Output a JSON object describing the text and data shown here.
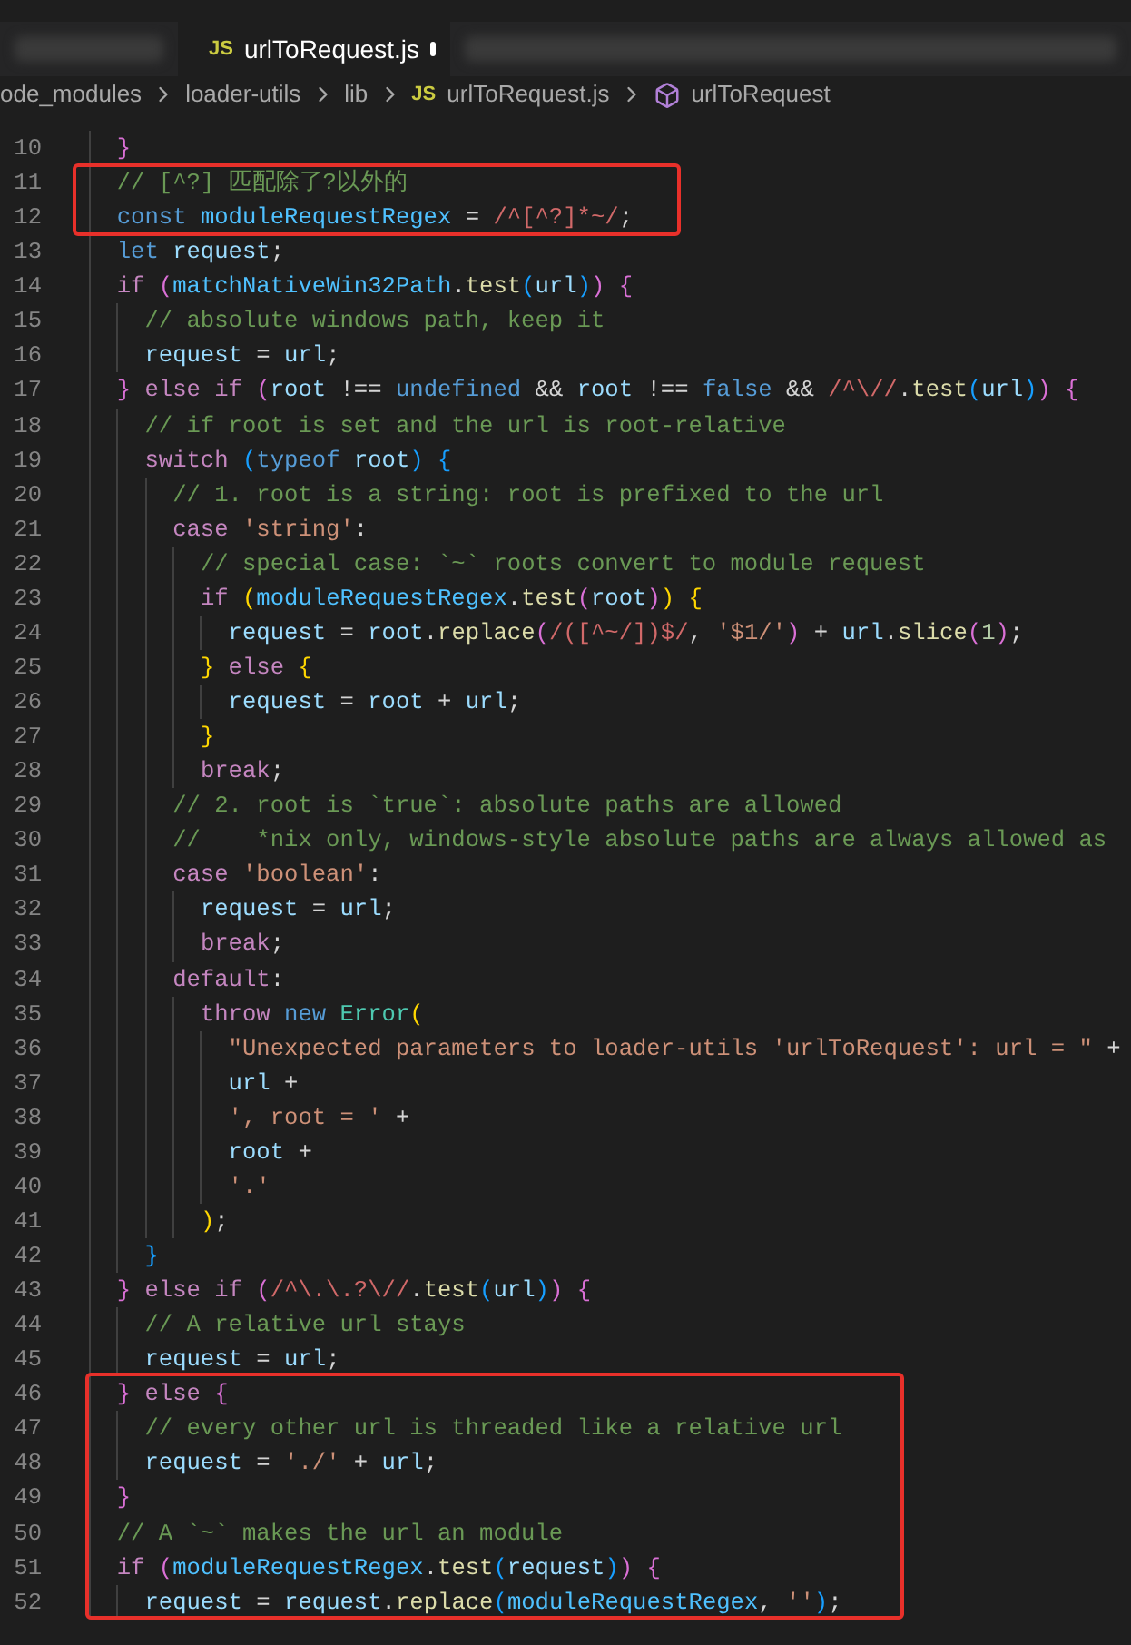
{
  "tabs": [
    {
      "kind": "blurred",
      "selected": false
    },
    {
      "kind": "file",
      "icon_text": "JS",
      "label": "urlToRequest.js",
      "modified": true,
      "selected": true
    },
    {
      "kind": "blurred",
      "selected": false
    }
  ],
  "breadcrumbs": [
    {
      "kind": "folder",
      "label": "ode_modules"
    },
    {
      "kind": "folder",
      "label": "loader-utils"
    },
    {
      "kind": "folder",
      "label": "lib"
    },
    {
      "kind": "file",
      "icon_text": "JS",
      "label": "urlToRequest.js"
    },
    {
      "kind": "symbol",
      "label": "urlToRequest"
    }
  ],
  "lines": [
    {
      "number": "10",
      "tokens": [
        {
          "kind": "bracket2",
          "text": "  }"
        }
      ]
    },
    {
      "number": "11",
      "tokens": [
        {
          "kind": "comment",
          "text": "  // [^?] 匹配除了?以外的"
        }
      ]
    },
    {
      "number": "12",
      "tokens": [
        {
          "kind": "keyword",
          "text": "  const "
        },
        {
          "kind": "constant",
          "text": "moduleRequestRegex"
        },
        {
          "kind": "plain",
          "text": " = "
        },
        {
          "kind": "regex",
          "text": "/^[^?]*~/"
        },
        {
          "kind": "plain",
          "text": ";"
        }
      ]
    },
    {
      "number": "13",
      "tokens": [
        {
          "kind": "keyword",
          "text": "  let "
        },
        {
          "kind": "variable",
          "text": "request"
        },
        {
          "kind": "plain",
          "text": ";"
        }
      ]
    },
    {
      "number": "14",
      "tokens": [
        {
          "kind": "control",
          "text": "  if "
        },
        {
          "kind": "bracket2",
          "text": "("
        },
        {
          "kind": "constant",
          "text": "matchNativeWin32Path"
        },
        {
          "kind": "plain",
          "text": "."
        },
        {
          "kind": "function",
          "text": "test"
        },
        {
          "kind": "bracket3",
          "text": "("
        },
        {
          "kind": "variable",
          "text": "url"
        },
        {
          "kind": "bracket3",
          "text": ")"
        },
        {
          "kind": "bracket2",
          "text": ") {"
        }
      ]
    },
    {
      "number": "15",
      "tokens": [
        {
          "kind": "comment",
          "text": "    // absolute windows path, keep it"
        }
      ]
    },
    {
      "number": "16",
      "tokens": [
        {
          "kind": "variable",
          "text": "    request"
        },
        {
          "kind": "plain",
          "text": " = "
        },
        {
          "kind": "variable",
          "text": "url"
        },
        {
          "kind": "plain",
          "text": ";"
        }
      ]
    },
    {
      "number": "17",
      "tokens": [
        {
          "kind": "bracket2",
          "text": "  } "
        },
        {
          "kind": "control",
          "text": "else if "
        },
        {
          "kind": "bracket2",
          "text": "("
        },
        {
          "kind": "variable",
          "text": "root"
        },
        {
          "kind": "plain",
          "text": " !== "
        },
        {
          "kind": "keyword",
          "text": "undefined"
        },
        {
          "kind": "plain",
          "text": " && "
        },
        {
          "kind": "variable",
          "text": "root"
        },
        {
          "kind": "plain",
          "text": " !== "
        },
        {
          "kind": "keyword",
          "text": "false"
        },
        {
          "kind": "plain",
          "text": " && "
        },
        {
          "kind": "regex",
          "text": "/^\\//"
        },
        {
          "kind": "plain",
          "text": "."
        },
        {
          "kind": "function",
          "text": "test"
        },
        {
          "kind": "bracket3",
          "text": "("
        },
        {
          "kind": "variable",
          "text": "url"
        },
        {
          "kind": "bracket3",
          "text": ")"
        },
        {
          "kind": "bracket2",
          "text": ") {"
        }
      ]
    },
    {
      "number": "18",
      "tokens": [
        {
          "kind": "comment",
          "text": "    // if root is set and the url is root-relative"
        }
      ]
    },
    {
      "number": "19",
      "tokens": [
        {
          "kind": "control",
          "text": "    switch "
        },
        {
          "kind": "bracket3",
          "text": "("
        },
        {
          "kind": "keyword",
          "text": "typeof "
        },
        {
          "kind": "variable",
          "text": "root"
        },
        {
          "kind": "bracket3",
          "text": ") {"
        }
      ]
    },
    {
      "number": "20",
      "tokens": [
        {
          "kind": "comment",
          "text": "      // 1. root is a string: root is prefixed to the url"
        }
      ]
    },
    {
      "number": "21",
      "tokens": [
        {
          "kind": "control",
          "text": "      case "
        },
        {
          "kind": "string",
          "text": "'string'"
        },
        {
          "kind": "plain",
          "text": ":"
        }
      ]
    },
    {
      "number": "22",
      "tokens": [
        {
          "kind": "comment",
          "text": "        // special case: `~` roots convert to module request"
        }
      ]
    },
    {
      "number": "23",
      "tokens": [
        {
          "kind": "control",
          "text": "        if "
        },
        {
          "kind": "bracket1",
          "text": "("
        },
        {
          "kind": "constant",
          "text": "moduleRequestRegex"
        },
        {
          "kind": "plain",
          "text": "."
        },
        {
          "kind": "function",
          "text": "test"
        },
        {
          "kind": "bracket2",
          "text": "("
        },
        {
          "kind": "variable",
          "text": "root"
        },
        {
          "kind": "bracket2",
          "text": ")"
        },
        {
          "kind": "bracket1",
          "text": ") {"
        }
      ]
    },
    {
      "number": "24",
      "tokens": [
        {
          "kind": "variable",
          "text": "          request"
        },
        {
          "kind": "plain",
          "text": " = "
        },
        {
          "kind": "variable",
          "text": "root"
        },
        {
          "kind": "plain",
          "text": "."
        },
        {
          "kind": "function",
          "text": "replace"
        },
        {
          "kind": "bracket2",
          "text": "("
        },
        {
          "kind": "regex",
          "text": "/([^~/])$/"
        },
        {
          "kind": "plain",
          "text": ", "
        },
        {
          "kind": "string",
          "text": "'$1/'"
        },
        {
          "kind": "bracket2",
          "text": ")"
        },
        {
          "kind": "plain",
          "text": " + "
        },
        {
          "kind": "variable",
          "text": "url"
        },
        {
          "kind": "plain",
          "text": "."
        },
        {
          "kind": "function",
          "text": "slice"
        },
        {
          "kind": "bracket2",
          "text": "("
        },
        {
          "kind": "number",
          "text": "1"
        },
        {
          "kind": "bracket2",
          "text": ")"
        },
        {
          "kind": "plain",
          "text": ";"
        }
      ]
    },
    {
      "number": "25",
      "tokens": [
        {
          "kind": "bracket1",
          "text": "        } "
        },
        {
          "kind": "control",
          "text": "else "
        },
        {
          "kind": "bracket1",
          "text": "{"
        }
      ]
    },
    {
      "number": "26",
      "tokens": [
        {
          "kind": "variable",
          "text": "          request"
        },
        {
          "kind": "plain",
          "text": " = "
        },
        {
          "kind": "variable",
          "text": "root"
        },
        {
          "kind": "plain",
          "text": " + "
        },
        {
          "kind": "variable",
          "text": "url"
        },
        {
          "kind": "plain",
          "text": ";"
        }
      ]
    },
    {
      "number": "27",
      "tokens": [
        {
          "kind": "bracket1",
          "text": "        }"
        }
      ]
    },
    {
      "number": "28",
      "tokens": [
        {
          "kind": "control",
          "text": "        break"
        },
        {
          "kind": "plain",
          "text": ";"
        }
      ]
    },
    {
      "number": "29",
      "tokens": [
        {
          "kind": "comment",
          "text": "      // 2. root is `true`: absolute paths are allowed"
        }
      ]
    },
    {
      "number": "30",
      "tokens": [
        {
          "kind": "comment",
          "text": "      //    *nix only, windows-style absolute paths are always allowed as"
        }
      ]
    },
    {
      "number": "31",
      "tokens": [
        {
          "kind": "control",
          "text": "      case "
        },
        {
          "kind": "string",
          "text": "'boolean'"
        },
        {
          "kind": "plain",
          "text": ":"
        }
      ]
    },
    {
      "number": "32",
      "tokens": [
        {
          "kind": "variable",
          "text": "        request"
        },
        {
          "kind": "plain",
          "text": " = "
        },
        {
          "kind": "variable",
          "text": "url"
        },
        {
          "kind": "plain",
          "text": ";"
        }
      ]
    },
    {
      "number": "33",
      "tokens": [
        {
          "kind": "control",
          "text": "        break"
        },
        {
          "kind": "plain",
          "text": ";"
        }
      ]
    },
    {
      "number": "34",
      "tokens": [
        {
          "kind": "control",
          "text": "      default"
        },
        {
          "kind": "plain",
          "text": ":"
        }
      ]
    },
    {
      "number": "35",
      "tokens": [
        {
          "kind": "control",
          "text": "        throw "
        },
        {
          "kind": "keyword",
          "text": "new "
        },
        {
          "kind": "class",
          "text": "Error"
        },
        {
          "kind": "bracket1",
          "text": "("
        }
      ]
    },
    {
      "number": "36",
      "tokens": [
        {
          "kind": "string",
          "text": "          \"Unexpected parameters to loader-utils 'urlToRequest': url = \""
        },
        {
          "kind": "plain",
          "text": " +"
        }
      ]
    },
    {
      "number": "37",
      "tokens": [
        {
          "kind": "variable",
          "text": "          url"
        },
        {
          "kind": "plain",
          "text": " +"
        }
      ]
    },
    {
      "number": "38",
      "tokens": [
        {
          "kind": "string",
          "text": "          ', root = '"
        },
        {
          "kind": "plain",
          "text": " +"
        }
      ]
    },
    {
      "number": "39",
      "tokens": [
        {
          "kind": "variable",
          "text": "          root"
        },
        {
          "kind": "plain",
          "text": " +"
        }
      ]
    },
    {
      "number": "40",
      "tokens": [
        {
          "kind": "string",
          "text": "          '.'"
        }
      ]
    },
    {
      "number": "41",
      "tokens": [
        {
          "kind": "bracket1",
          "text": "        )"
        },
        {
          "kind": "plain",
          "text": ";"
        }
      ]
    },
    {
      "number": "42",
      "tokens": [
        {
          "kind": "bracket3",
          "text": "    }"
        }
      ]
    },
    {
      "number": "43",
      "tokens": [
        {
          "kind": "bracket2",
          "text": "  } "
        },
        {
          "kind": "control",
          "text": "else if "
        },
        {
          "kind": "bracket2",
          "text": "("
        },
        {
          "kind": "regex",
          "text": "/^\\.\\.?\\//"
        },
        {
          "kind": "plain",
          "text": "."
        },
        {
          "kind": "function",
          "text": "test"
        },
        {
          "kind": "bracket3",
          "text": "("
        },
        {
          "kind": "variable",
          "text": "url"
        },
        {
          "kind": "bracket3",
          "text": ")"
        },
        {
          "kind": "bracket2",
          "text": ") {"
        }
      ]
    },
    {
      "number": "44",
      "tokens": [
        {
          "kind": "comment",
          "text": "    // A relative url stays"
        }
      ]
    },
    {
      "number": "45",
      "tokens": [
        {
          "kind": "variable",
          "text": "    request"
        },
        {
          "kind": "plain",
          "text": " = "
        },
        {
          "kind": "variable",
          "text": "url"
        },
        {
          "kind": "plain",
          "text": ";"
        }
      ]
    },
    {
      "number": "46",
      "tokens": [
        {
          "kind": "bracket2",
          "text": "  } "
        },
        {
          "kind": "control",
          "text": "else "
        },
        {
          "kind": "bracket2",
          "text": "{"
        }
      ]
    },
    {
      "number": "47",
      "tokens": [
        {
          "kind": "comment",
          "text": "    // every other url is threaded like a relative url"
        }
      ]
    },
    {
      "number": "48",
      "tokens": [
        {
          "kind": "variable",
          "text": "    request"
        },
        {
          "kind": "plain",
          "text": " = "
        },
        {
          "kind": "string",
          "text": "'./'"
        },
        {
          "kind": "plain",
          "text": " + "
        },
        {
          "kind": "variable",
          "text": "url"
        },
        {
          "kind": "plain",
          "text": ";"
        }
      ]
    },
    {
      "number": "49",
      "tokens": [
        {
          "kind": "bracket2",
          "text": "  }"
        }
      ]
    },
    {
      "number": "50",
      "tokens": [
        {
          "kind": "comment",
          "text": "  // A `~` makes the url an module"
        }
      ]
    },
    {
      "number": "51",
      "tokens": [
        {
          "kind": "control",
          "text": "  if "
        },
        {
          "kind": "bracket2",
          "text": "("
        },
        {
          "kind": "constant",
          "text": "moduleRequestRegex"
        },
        {
          "kind": "plain",
          "text": "."
        },
        {
          "kind": "function",
          "text": "test"
        },
        {
          "kind": "bracket3",
          "text": "("
        },
        {
          "kind": "variable",
          "text": "request"
        },
        {
          "kind": "bracket3",
          "text": ")"
        },
        {
          "kind": "bracket2",
          "text": ") {"
        }
      ]
    },
    {
      "number": "52",
      "tokens": [
        {
          "kind": "variable",
          "text": "    request"
        },
        {
          "kind": "plain",
          "text": " = "
        },
        {
          "kind": "variable",
          "text": "request"
        },
        {
          "kind": "plain",
          "text": "."
        },
        {
          "kind": "function",
          "text": "replace"
        },
        {
          "kind": "bracket3",
          "text": "("
        },
        {
          "kind": "constant",
          "text": "moduleRequestRegex"
        },
        {
          "kind": "plain",
          "text": ", "
        },
        {
          "kind": "string",
          "text": "''"
        },
        {
          "kind": "bracket3",
          "text": ")"
        },
        {
          "kind": "plain",
          "text": ";"
        }
      ]
    }
  ],
  "annotations": [
    {
      "kind": "box"
    },
    {
      "kind": "box"
    }
  ]
}
